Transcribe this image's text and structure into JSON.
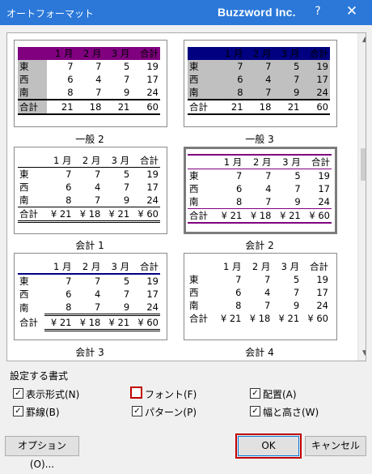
{
  "window": {
    "title": "オートフォーマット",
    "brand": "Buzzword Inc.",
    "help_label": "?",
    "close_label": "✕"
  },
  "formats": [
    {
      "name": "一般 2",
      "header": [
        "",
        "1 月",
        "2 月",
        "3 月",
        "合計"
      ],
      "rows": [
        [
          "東",
          "7",
          "7",
          "5",
          "19"
        ],
        [
          "西",
          "6",
          "4",
          "7",
          "17"
        ],
        [
          "南",
          "8",
          "7",
          "9",
          "24"
        ]
      ],
      "total": [
        "合計",
        "21",
        "18",
        "21",
        "60"
      ]
    },
    {
      "name": "一般 3",
      "header": [
        "",
        "1 月",
        "2 月",
        "3 月",
        "合計"
      ],
      "rows": [
        [
          "東",
          "7",
          "7",
          "5",
          "19"
        ],
        [
          "西",
          "6",
          "4",
          "7",
          "17"
        ],
        [
          "南",
          "8",
          "7",
          "9",
          "24"
        ]
      ],
      "total": [
        "合計",
        "21",
        "18",
        "21",
        "60"
      ]
    },
    {
      "name": "会計 1",
      "header": [
        "",
        "1 月",
        "2 月",
        "3 月",
        "合計"
      ],
      "rows": [
        [
          "東",
          "7",
          "7",
          "5",
          "19"
        ],
        [
          "西",
          "6",
          "4",
          "7",
          "17"
        ],
        [
          "南",
          "8",
          "7",
          "9",
          "24"
        ]
      ],
      "total": [
        "合計",
        "¥ 21",
        "¥ 18",
        "¥ 21",
        "¥ 60"
      ]
    },
    {
      "name": "会計 2",
      "header": [
        "",
        "1 月",
        "2 月",
        "3 月",
        "合計"
      ],
      "rows": [
        [
          "東",
          "7",
          "7",
          "5",
          "19"
        ],
        [
          "西",
          "6",
          "4",
          "7",
          "17"
        ],
        [
          "南",
          "8",
          "7",
          "9",
          "24"
        ]
      ],
      "total": [
        "合計",
        "¥ 21",
        "¥ 18",
        "¥ 21",
        "¥ 60"
      ]
    },
    {
      "name": "会計 3",
      "header": [
        "",
        "1 月",
        "2 月",
        "3 月",
        "合計"
      ],
      "rows": [
        [
          "東",
          "7",
          "7",
          "5",
          "19"
        ],
        [
          "西",
          "6",
          "4",
          "7",
          "17"
        ],
        [
          "南",
          "8",
          "7",
          "9",
          "24"
        ]
      ],
      "total": [
        "合計",
        "¥ 21",
        "¥ 18",
        "¥ 21",
        "¥ 60"
      ]
    },
    {
      "name": "会計 4",
      "header": [
        "",
        "1 月",
        "2 月",
        "3 月",
        "合計"
      ],
      "rows": [
        [
          "東",
          "7",
          "7",
          "5",
          "19"
        ],
        [
          "西",
          "6",
          "4",
          "7",
          "17"
        ],
        [
          "南",
          "8",
          "7",
          "9",
          "24"
        ]
      ],
      "total": [
        "合計",
        "¥ 21",
        "¥ 18",
        "¥ 21",
        "¥ 60"
      ]
    }
  ],
  "selected_format": "会計 2",
  "options": {
    "group_label": "設定する書式",
    "items": [
      {
        "label": "表示形式(N)",
        "checked": true
      },
      {
        "label": "フォント(F)",
        "checked": false
      },
      {
        "label": "配置(A)",
        "checked": true
      },
      {
        "label": "罫線(B)",
        "checked": true
      },
      {
        "label": "パターン(P)",
        "checked": true
      },
      {
        "label": "幅と高さ(W)",
        "checked": true
      }
    ]
  },
  "buttons": {
    "options": "オプション(O)...",
    "ok": "OK",
    "cancel": "キャンセル"
  },
  "colors": {
    "titlebar": "#2b78d9",
    "purple": "#800080",
    "navy": "#000080",
    "gray": "#c0c0c0",
    "highlight": "#c00000"
  }
}
